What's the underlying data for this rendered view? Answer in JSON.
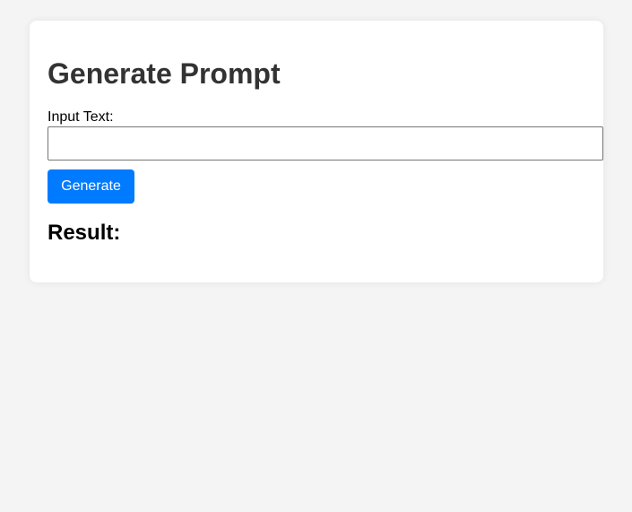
{
  "form": {
    "title": "Generate Prompt",
    "input_label": "Input Text:",
    "input_value": "",
    "input_placeholder": "",
    "generate_label": "Generate",
    "result_heading": "Result:",
    "result_text": ""
  },
  "colors": {
    "page_background": "#f4f4f4",
    "card_background": "#ffffff",
    "button_accent": "#007bff",
    "title_text": "#333333"
  }
}
